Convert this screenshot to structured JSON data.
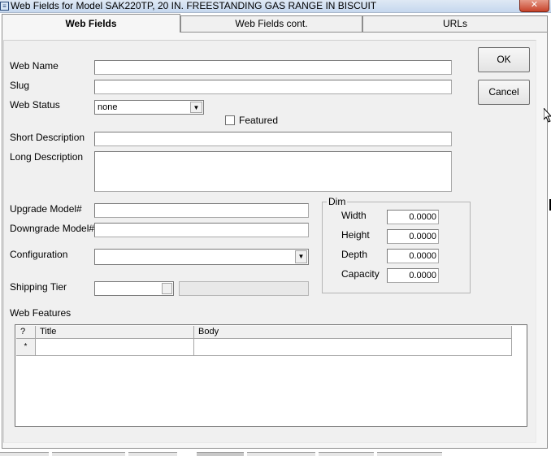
{
  "window": {
    "title": "Web Fields for Model SAK220TP, 20 IN. FREESTANDING GAS RANGE IN BISCUIT",
    "close_glyph": "✕"
  },
  "tabs": [
    {
      "label": "Web Fields",
      "active": true
    },
    {
      "label": "Web Fields cont.",
      "active": false
    },
    {
      "label": "URLs",
      "active": false
    }
  ],
  "buttons": {
    "ok": "OK",
    "cancel": "Cancel"
  },
  "fields": {
    "web_name": {
      "label": "Web Name",
      "value": ""
    },
    "slug": {
      "label": "Slug",
      "value": ""
    },
    "web_status": {
      "label": "Web Status",
      "value": "none"
    },
    "featured": {
      "label": "Featured",
      "checked": false
    },
    "short_description": {
      "label": "Short Description",
      "value": ""
    },
    "long_description": {
      "label": "Long Description",
      "value": ""
    },
    "upgrade_model": {
      "label": "Upgrade Model#",
      "value": ""
    },
    "downgrade_model": {
      "label": "Downgrade Model#",
      "value": ""
    },
    "configuration": {
      "label": "Configuration",
      "value": ""
    },
    "shipping_tier": {
      "label": "Shipping Tier",
      "value": "",
      "description": ""
    }
  },
  "dim": {
    "label": "Dim",
    "width": {
      "label": "Width",
      "value": "0.0000"
    },
    "height": {
      "label": "Height",
      "value": "0.0000"
    },
    "depth": {
      "label": "Depth",
      "value": "0.0000"
    },
    "capacity": {
      "label": "Capacity",
      "value": "0.0000"
    }
  },
  "web_features": {
    "label": "Web Features",
    "columns": [
      "?",
      "Title",
      "Body"
    ],
    "new_row_marker": "*"
  },
  "icons": {
    "dropdown": "▼"
  },
  "colors": {
    "close_button": "#c7432a",
    "titlebar": "#c5d7ee",
    "panel": "#f0f0f0"
  }
}
